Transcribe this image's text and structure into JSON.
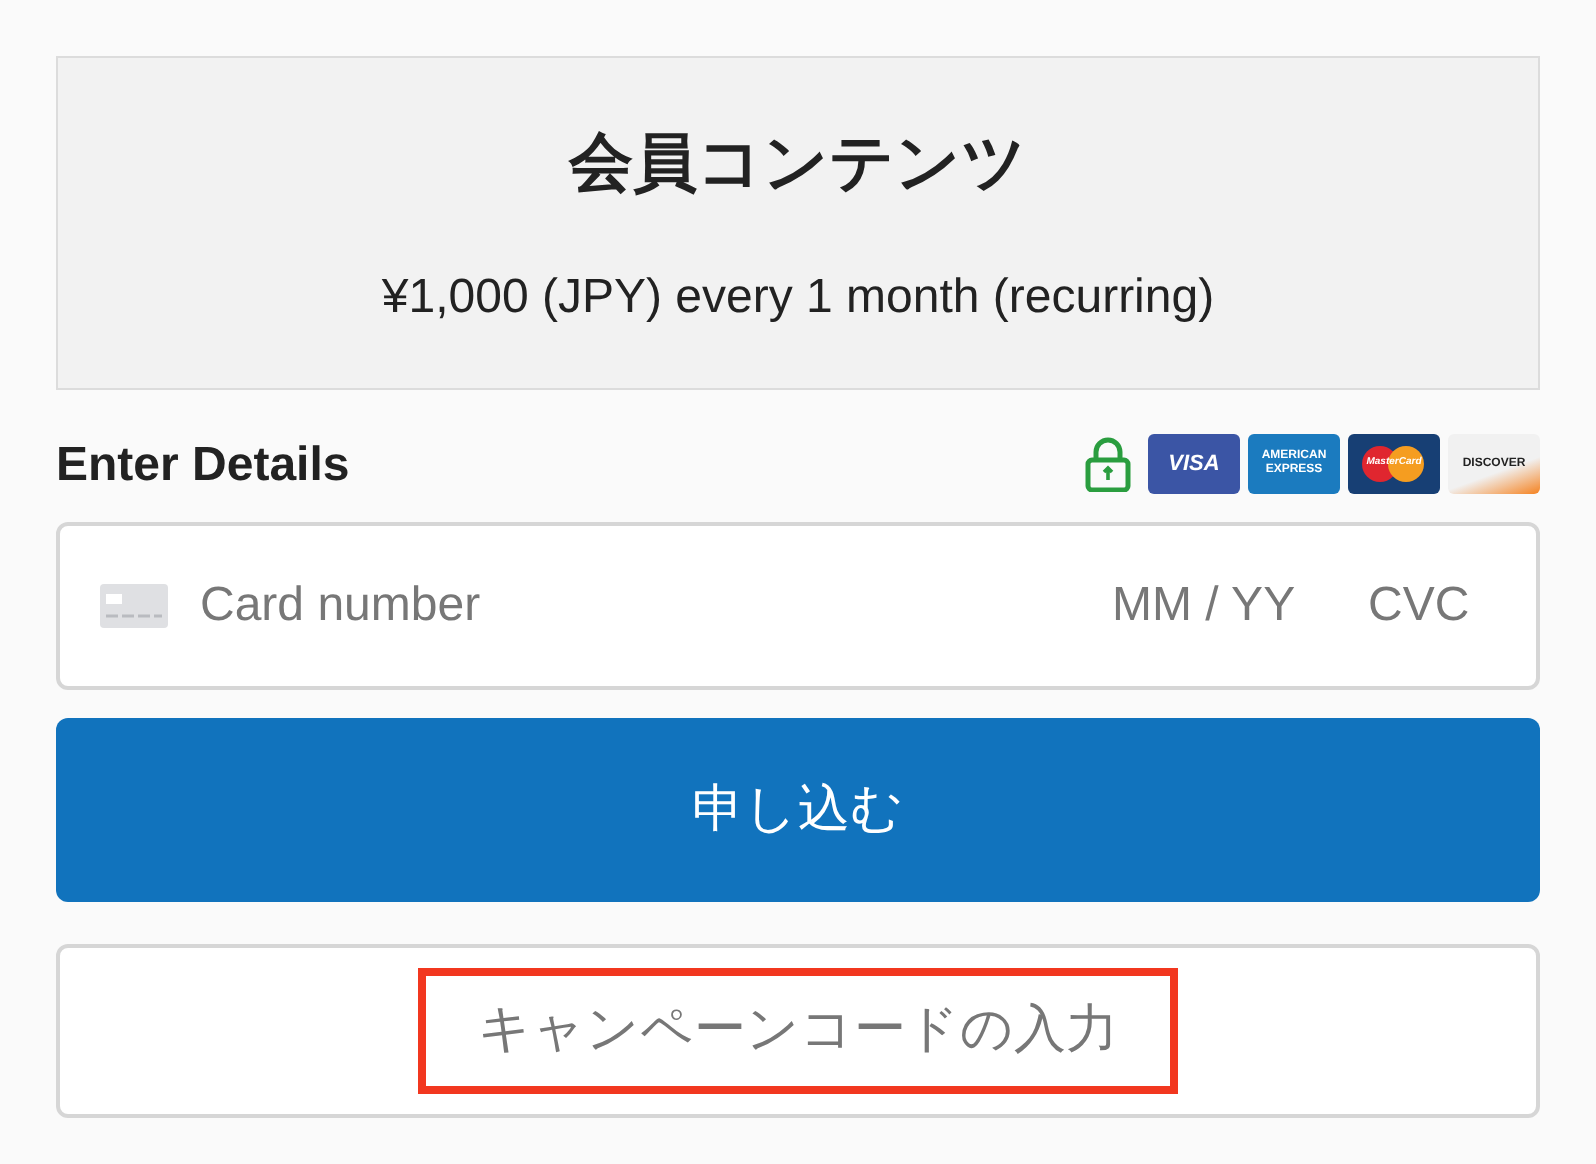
{
  "plan": {
    "title": "会員コンテンツ",
    "price": "¥1,000 (JPY) every 1 month (recurring)"
  },
  "details": {
    "heading": "Enter Details",
    "badges": [
      {
        "kind": "lock"
      },
      {
        "kind": "visa",
        "label": "VISA"
      },
      {
        "kind": "amex",
        "label": "AMERICAN EXPRESS"
      },
      {
        "kind": "mastercard",
        "label": "MasterCard"
      },
      {
        "kind": "discover",
        "label": "DISCOVER"
      }
    ]
  },
  "card_field": {
    "placeholder": "Card number",
    "expiry_placeholder": "MM / YY",
    "cvc_placeholder": "CVC"
  },
  "submit_button": "申し込む",
  "campaign_button": {
    "label": "キャンペーンコードの入力",
    "highlighted": true
  }
}
